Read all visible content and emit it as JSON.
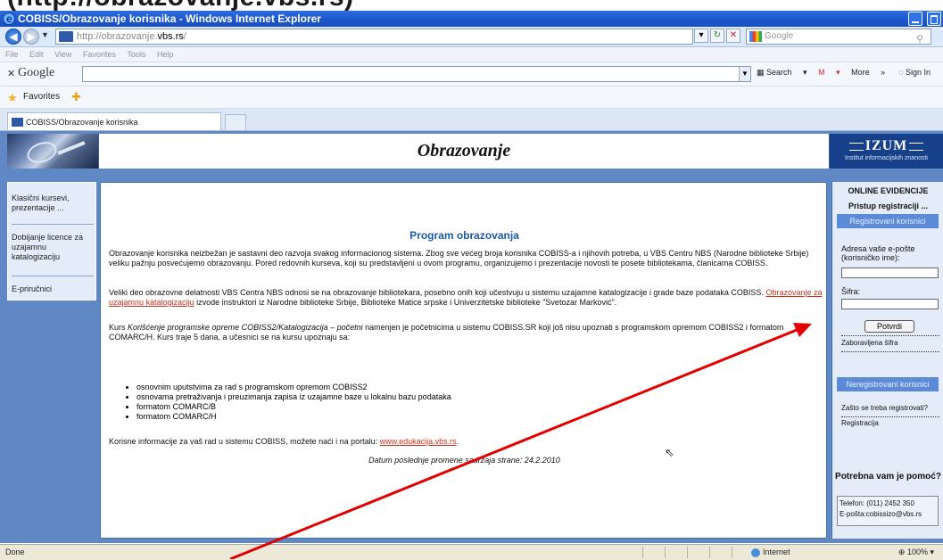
{
  "caption": "(http://obrazovanje.vbs.rs)",
  "window": {
    "title": "COBISS/Obrazovanje korisnika - Windows Internet Explorer"
  },
  "address_bar": {
    "url_prefix": "http://obrazovanje.",
    "url_domain": "vbs.rs",
    "url_suffix": "/",
    "search_placeholder": "Google"
  },
  "menu": [
    "File",
    "Edit",
    "View",
    "Favorites",
    "Tools",
    "Help"
  ],
  "google_toolbar": {
    "logo": "Google",
    "search_label": "Search",
    "mail_label": "M",
    "more_label": "More",
    "signin_label": "Sign In"
  },
  "favorites_bar": {
    "label": "Favorites"
  },
  "tab": {
    "label": "COBISS/Obrazovanje korisnika"
  },
  "header": {
    "title": "Obrazovanje",
    "logo": "IZUM",
    "logo_sub": "Institut informacijskih znanosti"
  },
  "sidebar": {
    "items": [
      {
        "label": "Klasični kursevi, prezentacije ..."
      },
      {
        "label": "Dobijanje licence za uzajamnu katalogizaciju"
      },
      {
        "label": "E-priručnici"
      }
    ]
  },
  "content": {
    "title": "Program obrazovanja",
    "p1": "Obrazovanje korisnika neizbežan je sastavni deo razvoja svakog informacionog sistema. Zbog sve većeg broja korisnika COBISS-a i njihovih potreba, u VBS Centru NBS (Narodne biblioteke Srbije) veliku pažnju posvećujemo obrazovanju. Pored redovnih kurseva, koji su predstavljeni u ovom programu, organizujemo i prezentacije novosti te posete bibliotekama, članicama COBISS.",
    "p2_before": "Veliki deo obrazovne delatnosti VBS Centra NBS odnosi se na obrazovanje bibliotekara, posebno onih koji učestvuju u sistemu uzajamne katalogizacije i grade baze podataka COBISS. ",
    "p2_link": "Obrazovanje za uzajamnu katalogizaciju",
    "p2_after": " izvode instruktori iz Narodne biblioteke Srbije, Biblioteke Matice srpske i Univerzitetske biblioteke \"Svetozar Marković\".",
    "p3_before": "Kurs ",
    "p3_italic": "Korišćenje programske opreme COBISS2/Katalogizacija – početni",
    "p3_after": " namenjen je početnicima u sistemu COBISS.SR koji još nisu upoznati s programskom opremom COBISS2 i formatom COMARC/H. Kurs traje 5 dana, a učesnici se na kursu upoznaju sa:",
    "bullets": [
      "osnovnim uputstvima za rad s programskom opremom COBISS2",
      "osnovama pretraživanja i preuzimanja zapisa iz uzajamne baze u lokalnu bazu podataka",
      "formatom COMARC/B",
      "formatom COMARC/H"
    ],
    "p4_before": "Korisne informacije za vaš rad u sistemu COBISS, možete naći i na portalu: ",
    "p4_link": "www.edukacija.vbs.rs",
    "p4_after": ".",
    "date_line": "Datum poslednje promene sadržaja strane: 24.2.2010"
  },
  "right_panel": {
    "heading": "ONLINE EVIDENCIJE",
    "subheading": "Pristup registraciji ...",
    "registered": "Registrovani korisnici",
    "email_label": "Adresa vaše e-pošte (korisničko ime):",
    "password_label": "Šifra:",
    "confirm_button": "Potvrdi",
    "forgot_link": "Zaboravljena šifra",
    "unregistered": "Neregistrovani korisnici",
    "why_register_link": "Zašto se treba registrovati?",
    "register_link": "Registracija",
    "help_heading": "Potrebna vam je pomoć?",
    "phone": "Telefon: (011) 2452 350",
    "email": "E-pošta:cobissizo@vbs.rs"
  },
  "status_bar": {
    "left": "Done",
    "zone": "Internet",
    "zoom": "100%"
  },
  "colors": {
    "page_frame": "#5f88c4",
    "title_blue": "#1d5aa4",
    "link_red": "#c9321e",
    "arrow": "#e00000"
  }
}
